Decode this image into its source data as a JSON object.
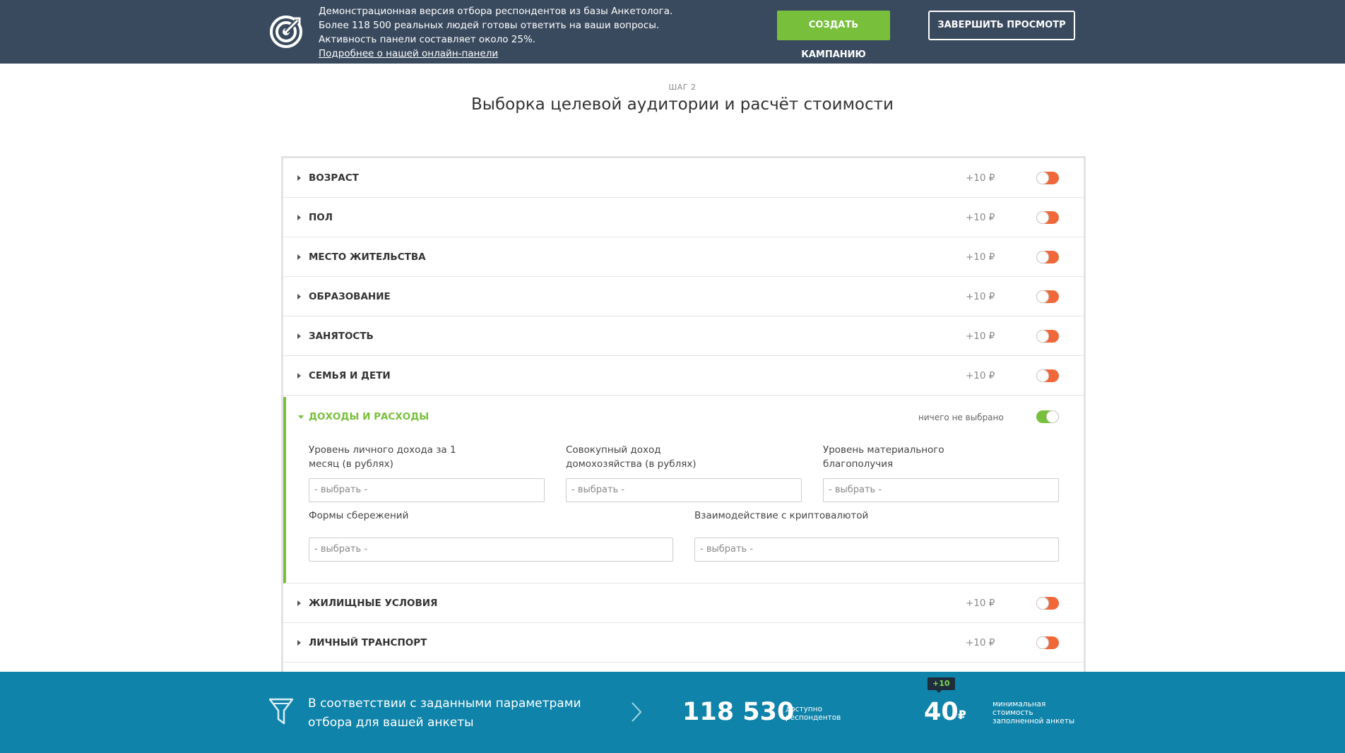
{
  "banner": {
    "line1": "Демонстрационная версия отбора респондентов из базы Анкетолога.",
    "line2": "Более 118 500 реальных людей готовы ответить на ваши вопросы.",
    "line3": "Активность панели составляет около 25%.",
    "link": "Подробнее о нашей онлайн-панели",
    "create_button": "СОЗДАТЬ КАМПАНИЮ",
    "finish_button": "ЗАВЕРШИТЬ ПРОСМОТР",
    "logo_icon": "target-logo-icon"
  },
  "header": {
    "step": "ШАГ 2",
    "title": "Выборка целевой аудитории и расчёт стоимости"
  },
  "sections": [
    {
      "label": "ВОЗРАСТ",
      "price": "+10 ₽",
      "enabled": false
    },
    {
      "label": "ПОЛ",
      "price": "+10 ₽",
      "enabled": false
    },
    {
      "label": "МЕСТО ЖИТЕЛЬСТВА",
      "price": "+10 ₽",
      "enabled": false
    },
    {
      "label": "ОБРАЗОВАНИЕ",
      "price": "+10 ₽",
      "enabled": false
    },
    {
      "label": "ЗАНЯТОСТЬ",
      "price": "+10 ₽",
      "enabled": false
    },
    {
      "label": "СЕМЬЯ И ДЕТИ",
      "price": "+10 ₽",
      "enabled": false
    },
    {
      "label": "ЖИЛИЩНЫЕ УСЛОВИЯ",
      "price": "+10 ₽",
      "enabled": false
    },
    {
      "label": "ЛИЧНЫЙ ТРАНСПОРТ",
      "price": "+10 ₽",
      "enabled": false
    }
  ],
  "expanded": {
    "label": "ДОХОДЫ И РАСХОДЫ",
    "status": "ничего не выбрано",
    "enabled": true,
    "fields": [
      {
        "label_line1": "Уровень личного дохода за 1",
        "label_line2": "месяц (в рублях)",
        "placeholder": "- выбрать -"
      },
      {
        "label_line1": "Совокупный доход",
        "label_line2": "домохозяйства (в рублях)",
        "placeholder": "- выбрать -"
      },
      {
        "label_line1": "Уровень материального",
        "label_line2": "благополучия",
        "placeholder": "- выбрать -"
      },
      {
        "label_line1": "Формы сбережений",
        "label_line2": "",
        "placeholder": "- выбрать -"
      },
      {
        "label_line1": "Взаимодействие с криптовалютой",
        "label_line2": "",
        "placeholder": "- выбрать -"
      }
    ]
  },
  "footer": {
    "text_line1": "В соответствии с заданными параметрами",
    "text_line2": "отбора для вашей анкеты",
    "count": "118 530",
    "count_label_line1": "доступно",
    "count_label_line2": "респондентов",
    "badge": "+10",
    "price": "40",
    "currency": "₽",
    "price_label_line1": "минимальная",
    "price_label_line2": "стоимость",
    "price_label_line3": "заполненной анкеты",
    "funnel_icon": "funnel-icon",
    "chevron_icon": "chevron-right-icon"
  },
  "colors": {
    "topbar": "#3a4a5e",
    "accent_green": "#78c03c",
    "toggle_off": "#f0683a",
    "footer": "#0f83a9"
  }
}
